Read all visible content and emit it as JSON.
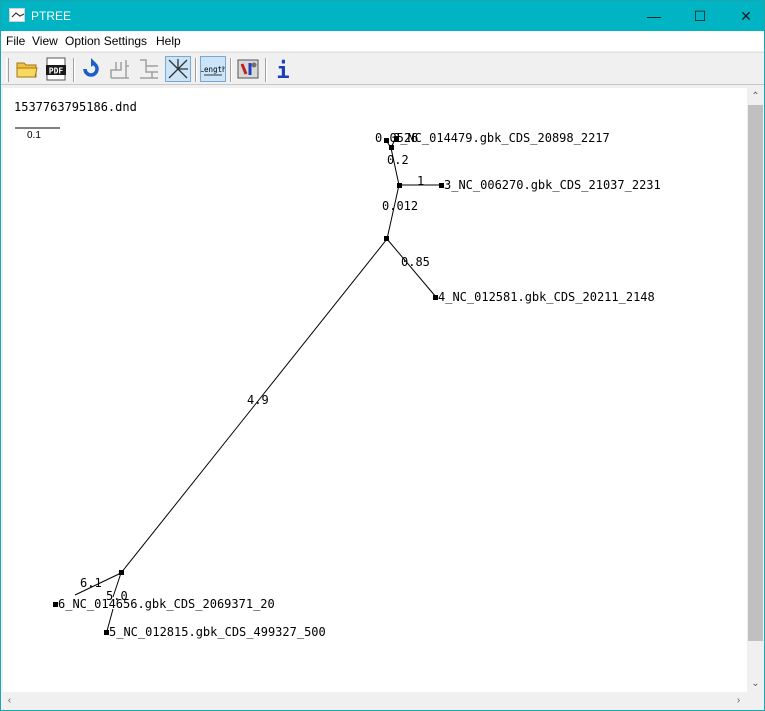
{
  "window": {
    "title": "PTREE",
    "minimize_glyph": "—",
    "maximize_glyph": "☐",
    "close_glyph": "✕"
  },
  "menu": {
    "file": "File",
    "view": "View",
    "option_settings": "Option Settings",
    "help": "Help"
  },
  "toolbar": {
    "buttons": [
      {
        "icon": "open-folder-icon"
      },
      {
        "icon": "pdf-icon",
        "label": "PDF"
      },
      {
        "icon": "refresh-icon"
      },
      {
        "icon": "tree-layout-icon"
      },
      {
        "icon": "tree-layout-alt-icon"
      },
      {
        "icon": "unrooted-tree-icon"
      },
      {
        "icon": "length-icon",
        "label": "Length"
      },
      {
        "icon": "settings-tools-icon"
      },
      {
        "icon": "info-icon",
        "label": "i"
      }
    ]
  },
  "document": {
    "filename": "1537763795186.dnd",
    "scale_value": "0.1"
  },
  "tree": {
    "leaves": [
      {
        "label": "2_NC_014479.gbk_CDS_20898_2217"
      },
      {
        "label": "3_NC_006270.gbk_CDS_21037_2231"
      },
      {
        "label": "4_NC_012581.gbk_CDS_20211_2148"
      },
      {
        "label": "6_NC_014656.gbk_CDS_2069371_20"
      },
      {
        "label": "5_NC_012815.gbk_CDS_499327_500"
      }
    ],
    "branch_labels": {
      "top_cluster": "0.0526",
      "b_02": "0.2",
      "b_1": "1",
      "b_0012": "0.012",
      "b_085": "0.85",
      "b_49": "4.9",
      "b_61": "6.1",
      "b_50": "5.0"
    }
  }
}
